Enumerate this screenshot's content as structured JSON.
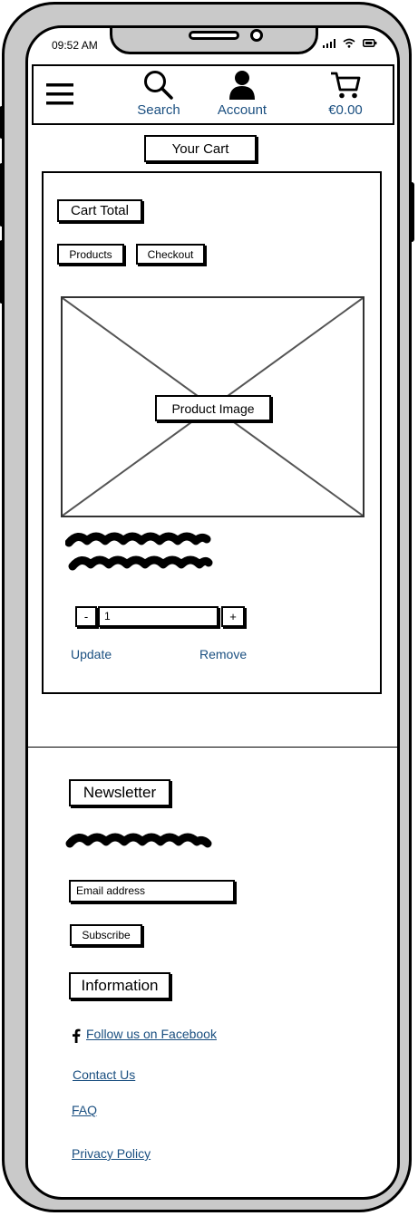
{
  "status": {
    "time": "09:52 AM"
  },
  "nav": {
    "menu_icon": "hamburger-icon",
    "search_label": "Search",
    "account_label": "Account",
    "cart_label": "€0.00"
  },
  "page_title": "Your Cart",
  "cart": {
    "total_label": "Cart Total",
    "products_button": "Products",
    "checkout_button": "Checkout",
    "image_label": "Product Image",
    "qty_minus": "-",
    "qty_value": "1",
    "qty_plus": "+",
    "update_link": "Update",
    "remove_link": "Remove"
  },
  "footer": {
    "newsletter_heading": "Newsletter",
    "email_placeholder": "Email address",
    "subscribe_button": "Subscribe",
    "information_heading": "Information",
    "facebook_link": "Follow us on Facebook",
    "contact_link": "Contact Us",
    "faq_link": "FAQ",
    "privacy_link": "Privacy Policy"
  },
  "colors": {
    "link": "#1a4f80",
    "frame": "#c9c9c9"
  }
}
